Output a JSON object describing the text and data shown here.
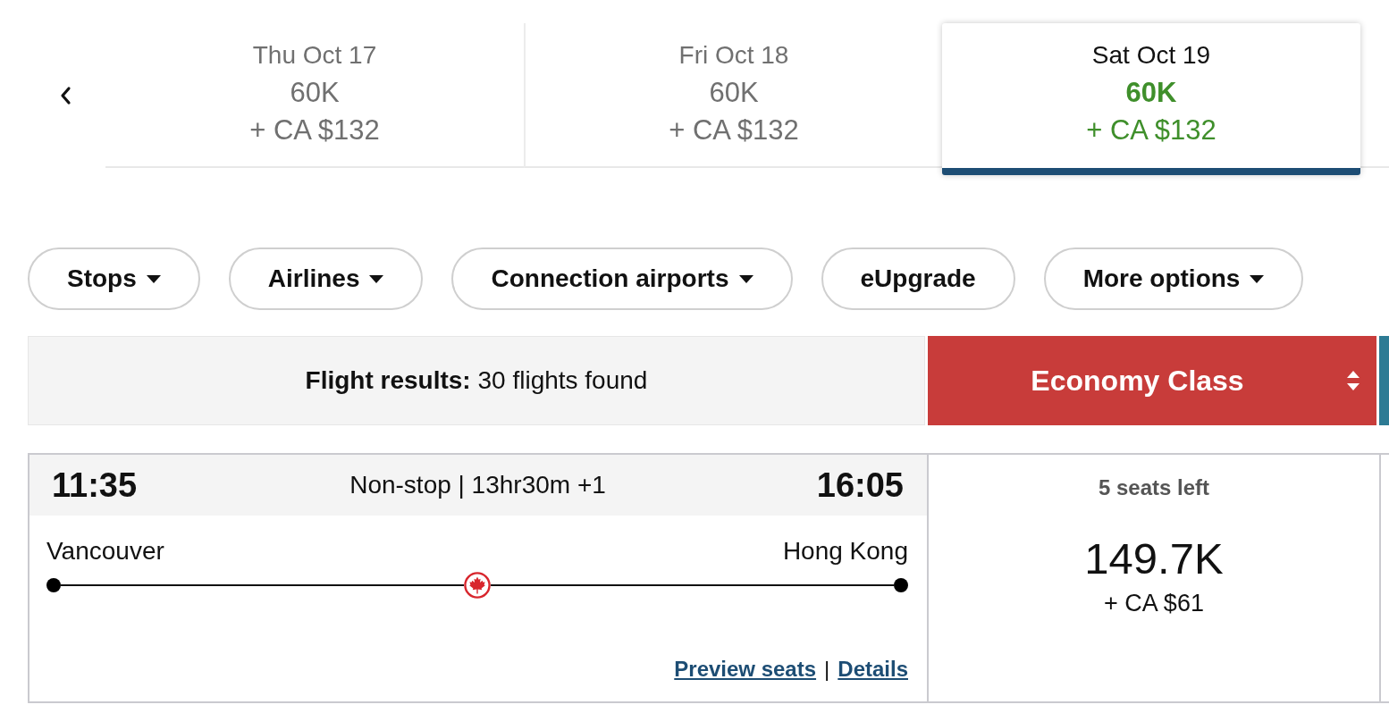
{
  "date_tabs": [
    {
      "date": "Thu Oct 17",
      "points": "60K",
      "price": "+ CA $132",
      "selected": false
    },
    {
      "date": "Fri Oct 18",
      "points": "60K",
      "price": "+ CA $132",
      "selected": false
    },
    {
      "date": "Sat Oct 19",
      "points": "60K",
      "price": "+ CA $132",
      "selected": true
    }
  ],
  "filters": [
    {
      "label": "Stops",
      "has_dropdown": true
    },
    {
      "label": "Airlines",
      "has_dropdown": true
    },
    {
      "label": "Connection airports",
      "has_dropdown": true
    },
    {
      "label": "eUpgrade",
      "has_dropdown": false
    },
    {
      "label": "More options",
      "has_dropdown": true
    }
  ],
  "results_bar": {
    "summary": "**Flight results:** 30 flights found",
    "cabin_selector": "Economy Class"
  },
  "flights": [
    {
      "departure_time": "11:35",
      "summary": "Non-stop | 13hr30m +1",
      "arrival_time": "16:05",
      "origin": "Vancouver",
      "destination": "Hong Kong",
      "links": [
        "Preview seats",
        "Details"
      ],
      "link_separator": "|",
      "seats_left": "5 seats left",
      "points": "149.7K",
      "price": "+ CA $61"
    }
  ]
}
